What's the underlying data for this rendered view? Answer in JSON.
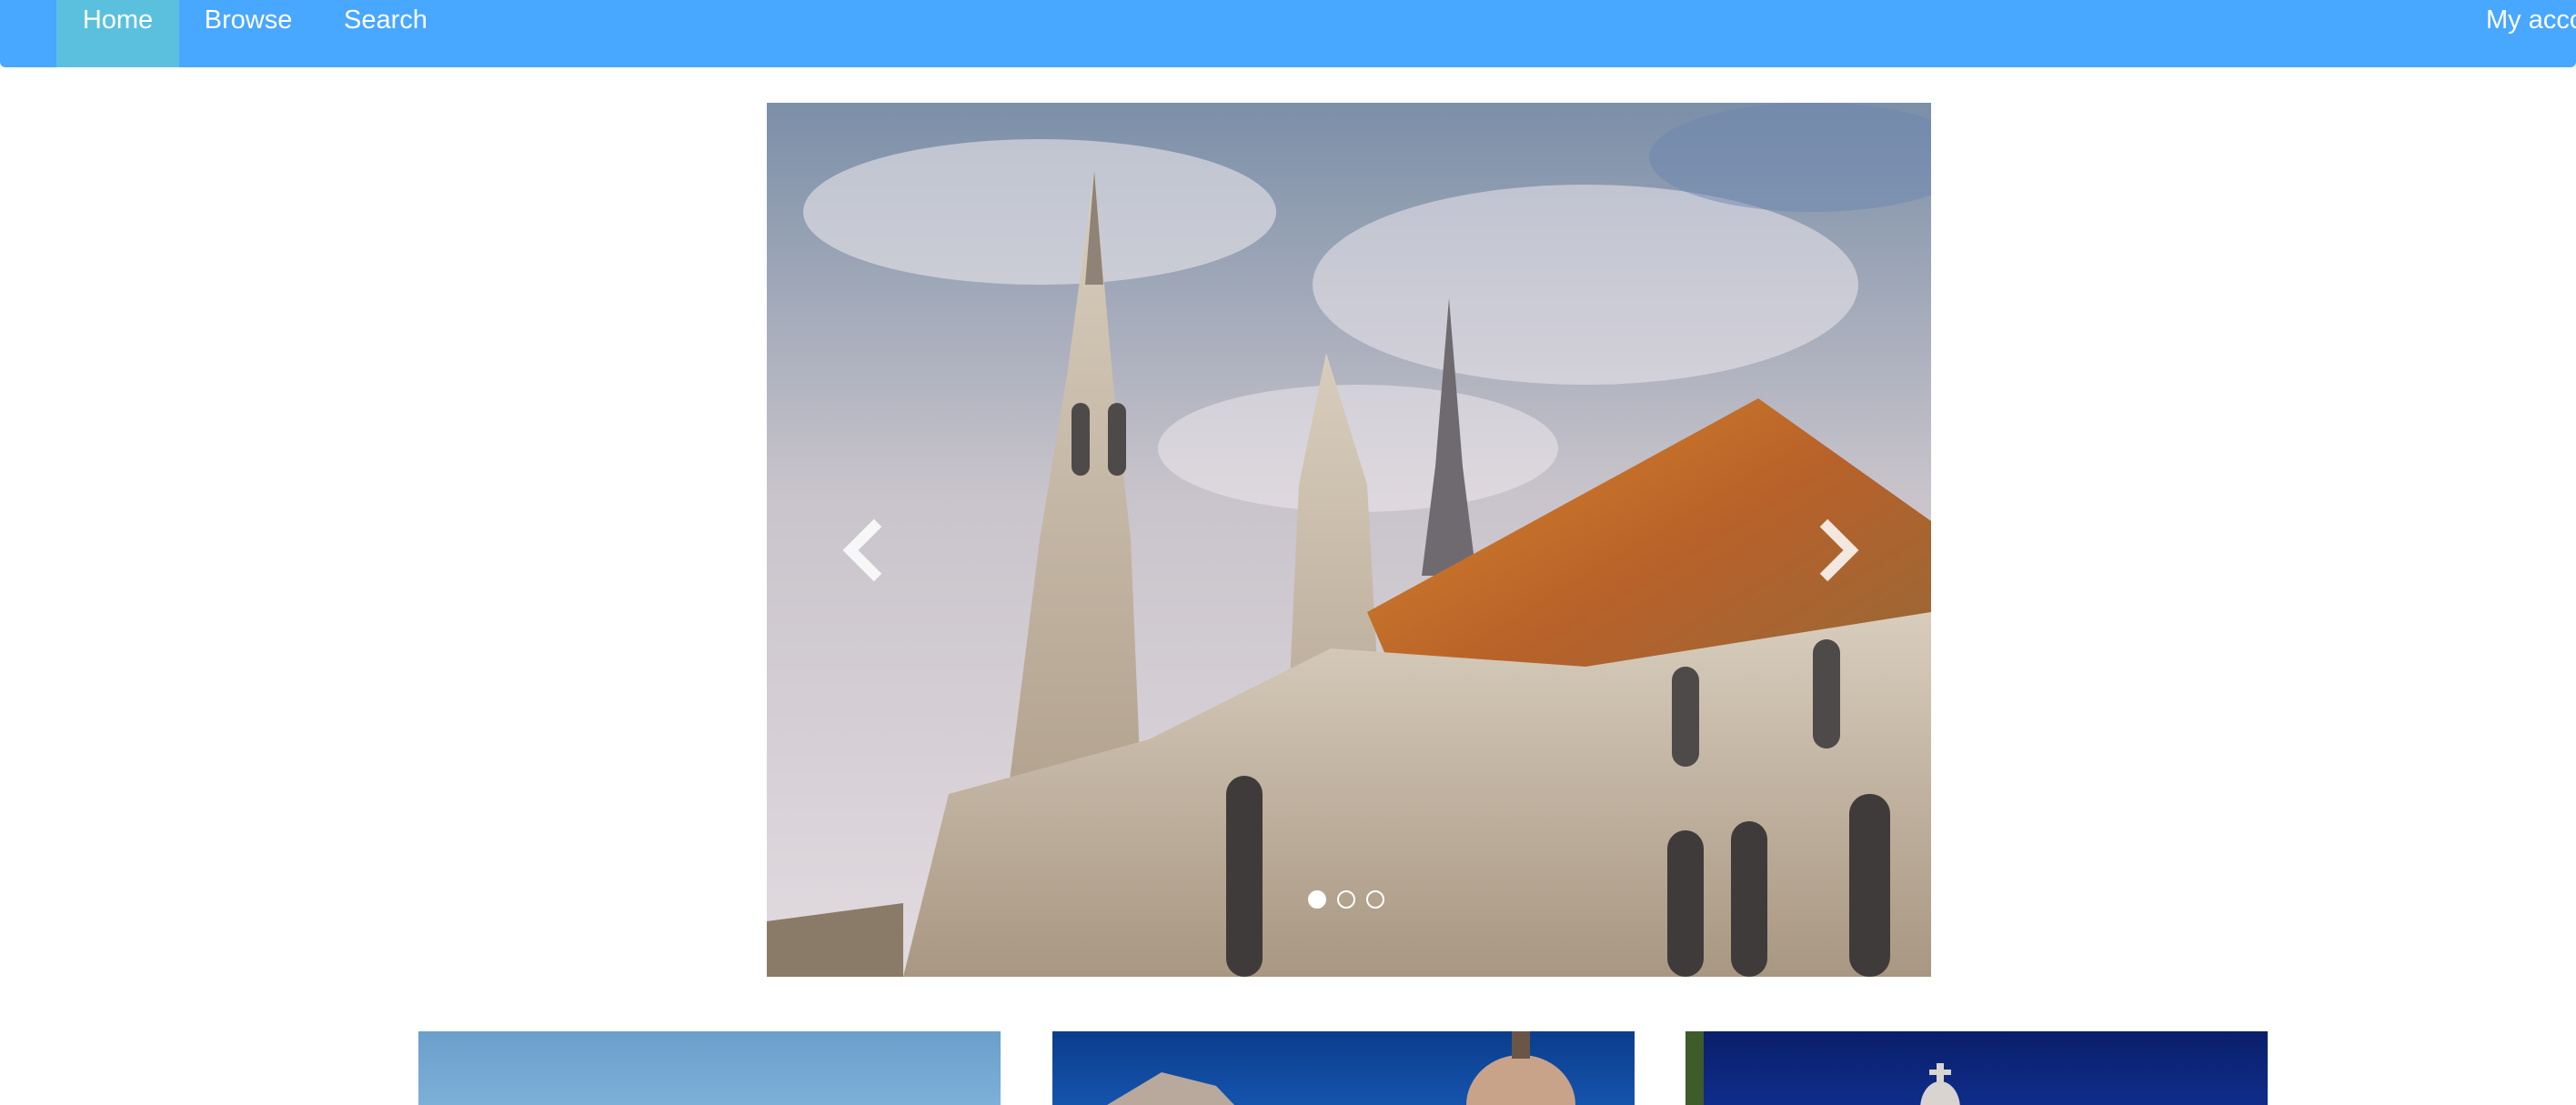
{
  "nav": {
    "home": "Home",
    "browse": "Browse",
    "search": "Search",
    "account": "My acco"
  },
  "carousel": {
    "slide_count": 3,
    "active_slide": 1,
    "prev_icon": "chevron-left-icon",
    "next_icon": "chevron-right-icon"
  },
  "colors": {
    "navbar": "#48a7fe",
    "nav_active": "#5bc0de"
  }
}
